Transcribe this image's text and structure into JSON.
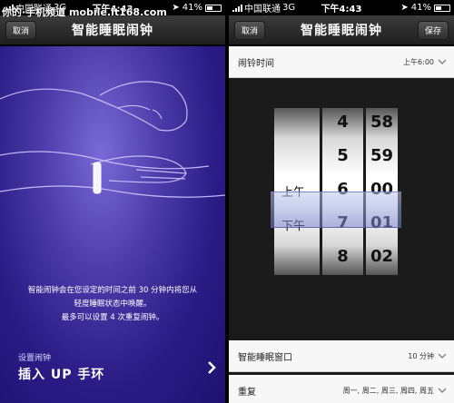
{
  "left": {
    "status": {
      "carrier": "中国联通",
      "network": "3G",
      "time": "下午4:43",
      "battery": "41%"
    },
    "nav": {
      "cancel": "取消",
      "title": "智能睡眠闹钟"
    },
    "description": [
      "智能闹钟会在您设定的时间之前 30 分钟内将您从",
      "轻度睡眠状态中唤醒。",
      "最多可以设置 4 次重复闹钟。"
    ],
    "plug": {
      "small": "设置闹钟",
      "big": "插入 UP 手环"
    }
  },
  "right": {
    "status": {
      "carrier": "中国联通",
      "network": "3G",
      "time": "下午4:43",
      "battery": "41%"
    },
    "nav": {
      "cancel": "取消",
      "title": "智能睡眠闹钟",
      "save": "保存"
    },
    "alarm_time": {
      "label": "闹铃时间",
      "value": "上午6:00"
    },
    "picker": {
      "ampm": [
        "上午",
        "下午"
      ],
      "hours": [
        "4",
        "5",
        "6",
        "7",
        "8"
      ],
      "minutes": [
        "58",
        "59",
        "00",
        "01",
        "02"
      ]
    },
    "sleep_window": {
      "label": "智能睡眠窗口",
      "value": "10 分钟"
    },
    "repeat": {
      "label": "重复",
      "value": "周一, 周二, 周三, 周四, 周五"
    }
  },
  "watermark": "你的·手机频道 mobile.it168.com",
  "colors": {
    "accent": "#3a2a9a",
    "row_bg": "#f7f7f7"
  }
}
